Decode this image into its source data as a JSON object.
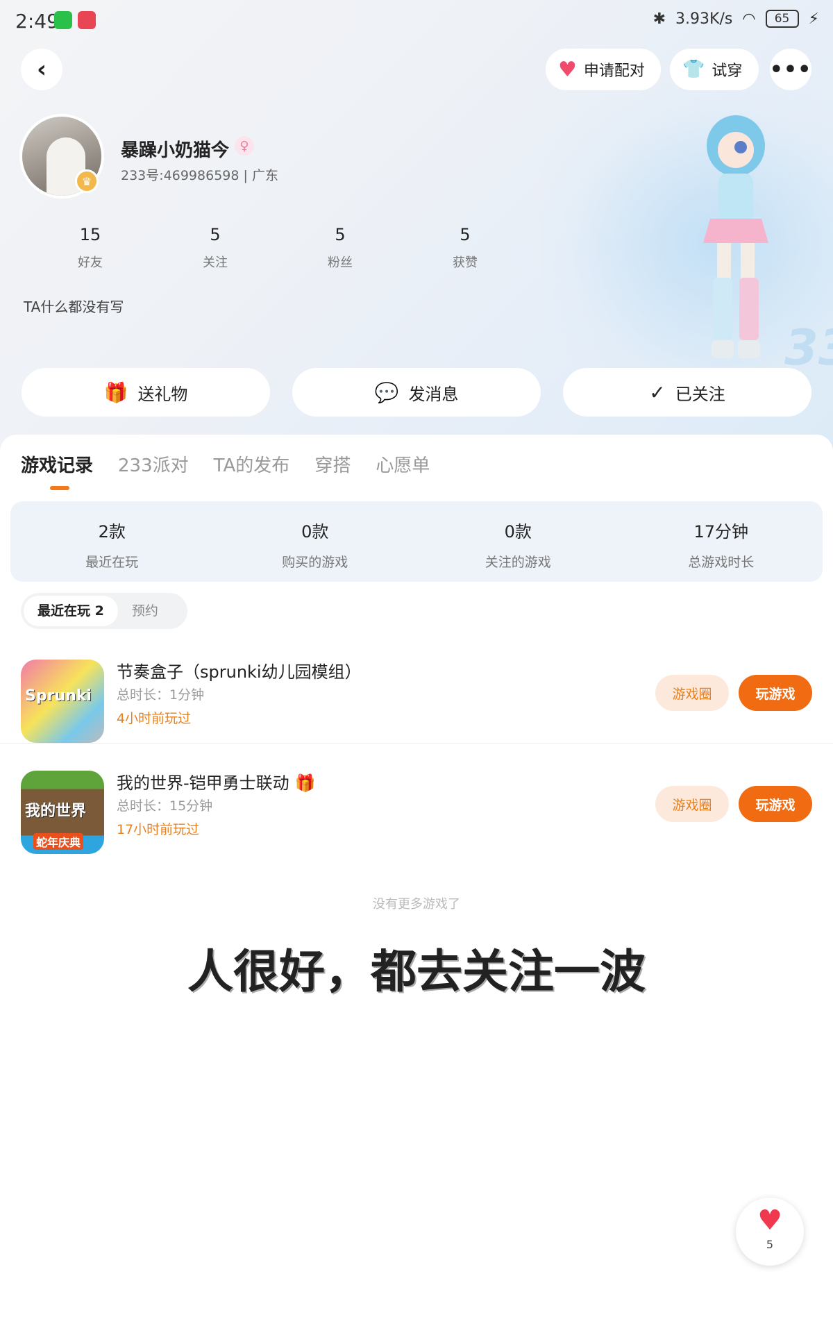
{
  "status_bar": {
    "time": "2:49",
    "speed": "3.93K/s",
    "battery": "65"
  },
  "header": {
    "match_label": "申请配对",
    "try_label": "试穿",
    "more_label": "•••"
  },
  "profile": {
    "nickname": "暴躁小奶猫今",
    "uid_line": "233号:469986598 | 广东",
    "stats": [
      {
        "num": "15",
        "label": "好友"
      },
      {
        "num": "5",
        "label": "关注"
      },
      {
        "num": "5",
        "label": "粉丝"
      },
      {
        "num": "5",
        "label": "获赞"
      }
    ],
    "bio": "TA什么都没有写"
  },
  "actions": {
    "gift": "送礼物",
    "message": "发消息",
    "follow": "已关注"
  },
  "tabs": [
    "游戏记录",
    "233派对",
    "TA的发布",
    "穿搭",
    "心愿单"
  ],
  "summary": [
    {
      "num": "2款",
      "label": "最近在玩"
    },
    {
      "num": "0款",
      "label": "购买的游戏"
    },
    {
      "num": "0款",
      "label": "关注的游戏"
    },
    {
      "num": "17分钟",
      "label": "总游戏时长"
    }
  ],
  "filter": {
    "recent": "最近在玩 2",
    "reserve": "预约"
  },
  "games": [
    {
      "title": "节奏盒子（sprunki幼儿园模组）",
      "duration": "总时长：1分钟",
      "last_played": "4小时前玩过",
      "circle_label": "游戏圈",
      "play_label": "玩游戏",
      "icon_text": "Sprunki"
    },
    {
      "title": "我的世界-铠甲勇士联动",
      "duration": "总时长：15分钟",
      "last_played": "17小时前玩过",
      "circle_label": "游戏圈",
      "play_label": "玩游戏",
      "icon_text": "我的世界",
      "icon_sub": "蛇年庆典"
    }
  ],
  "no_more": "没有更多游戏了",
  "caption": "人很好，都去关注一波",
  "like": {
    "count": "5"
  },
  "colors": {
    "accent": "#f06b12",
    "accent_soft": "#fde9dc",
    "heart": "#f0384e"
  }
}
